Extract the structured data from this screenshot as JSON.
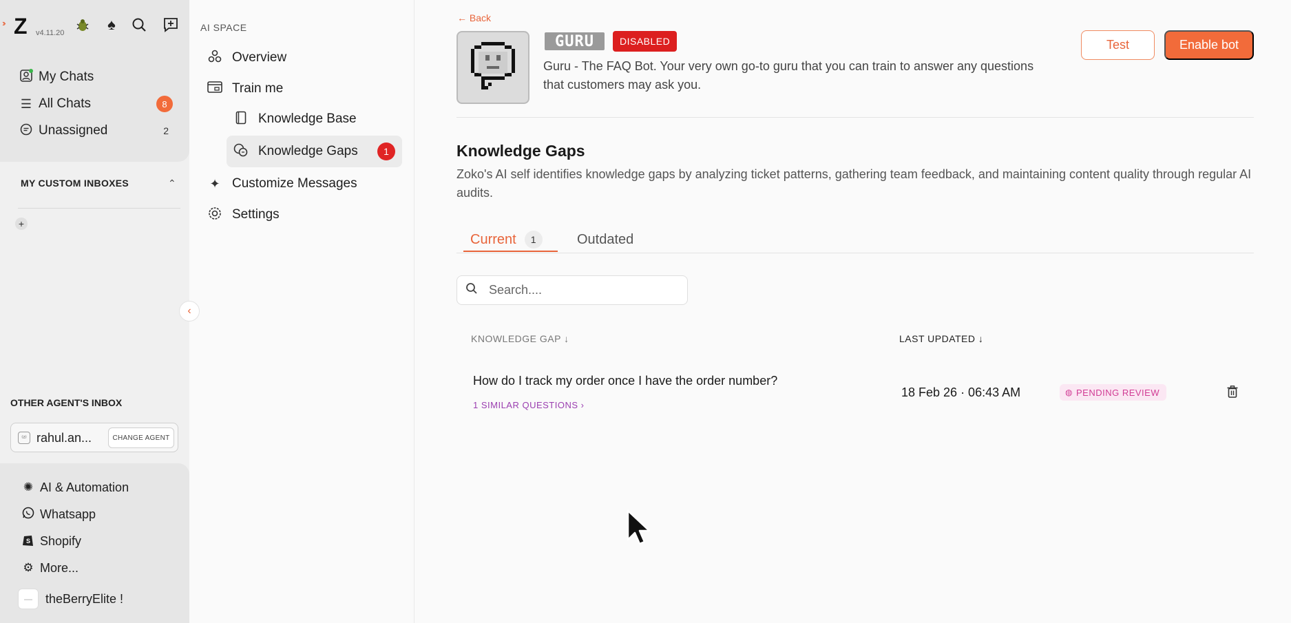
{
  "rail": {
    "version": "v4.11.20",
    "nav": [
      {
        "label": "My Chats",
        "icon": "user-icon"
      },
      {
        "label": "All Chats",
        "icon": "list-icon",
        "badge": "8"
      },
      {
        "label": "Unassigned",
        "icon": "chat-icon",
        "count": "2"
      }
    ],
    "custom_inboxes_title": "MY CUSTOM INBOXES",
    "other_agents_title": "OTHER AGENT'S INBOX",
    "agent_name": "rahul.an...",
    "change_agent_label": "CHANGE AGENT",
    "bottom": [
      {
        "label": "AI & Automation",
        "icon": "openai-icon"
      },
      {
        "label": "Whatsapp",
        "icon": "whatsapp-icon"
      },
      {
        "label": "Shopify",
        "icon": "shopify-icon"
      },
      {
        "label": "More...",
        "icon": "gear-icon"
      }
    ],
    "workspace": "theBerryElite !"
  },
  "sidebar": {
    "title": "AI SPACE",
    "items": [
      {
        "label": "Overview",
        "icon": "overview-icon"
      },
      {
        "label": "Train me",
        "icon": "train-icon"
      },
      {
        "label": "Knowledge Base",
        "icon": "book-icon"
      },
      {
        "label": "Knowledge Gaps",
        "icon": "gaps-icon",
        "badge": "1"
      },
      {
        "label": "Customize Messages",
        "icon": "sparkle-icon"
      },
      {
        "label": "Settings",
        "icon": "settings-icon"
      }
    ]
  },
  "main": {
    "back_label": "Back",
    "bot_logo_text": "GURU",
    "status": "DISABLED",
    "bot_description": "Guru - The FAQ Bot. Your very own go-to guru that you can train to answer any questions that customers may ask you.",
    "test_label": "Test",
    "enable_label": "Enable bot",
    "section_title": "Knowledge Gaps",
    "section_desc": "Zoko's AI self identifies knowledge gaps by analyzing ticket patterns, gathering team feedback, and maintaining content quality through regular AI audits.",
    "tabs": [
      {
        "label": "Current",
        "count": "1"
      },
      {
        "label": "Outdated"
      }
    ],
    "search_placeholder": "Search....",
    "columns": {
      "gap": "KNOWLEDGE GAP",
      "updated": "LAST UPDATED"
    },
    "rows": [
      {
        "question": "How do I track my order once I have the order number?",
        "similar": "1 SIMILAR QUESTIONS",
        "updated": "18 Feb 26 · 06:43 AM",
        "status": "PENDING REVIEW"
      }
    ]
  },
  "colors": {
    "accent": "#f26b3a",
    "danger": "#dc1f1f",
    "pending_bg": "#fbe7f3",
    "pending_text": "#d13b94",
    "similar_link": "#9b3fb0"
  }
}
